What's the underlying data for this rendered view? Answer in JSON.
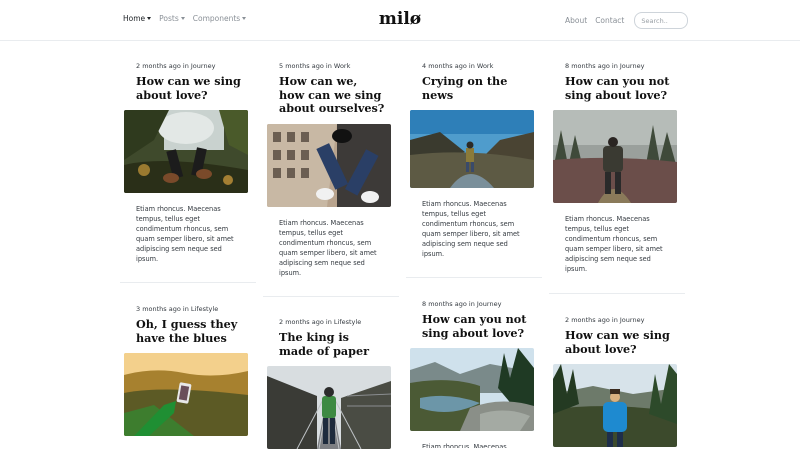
{
  "nav": {
    "brand": "milø",
    "left": [
      {
        "label": "Home",
        "dropdown": true,
        "active": true
      },
      {
        "label": "Posts",
        "dropdown": true,
        "active": false
      },
      {
        "label": "Components",
        "dropdown": true,
        "active": false
      }
    ],
    "about": "About",
    "contact": "Contact",
    "search_placeholder": "Search.."
  },
  "posts": [
    {
      "meta": "2 months ago in Journey",
      "title": "How can we sing about love?",
      "excerpt": "Etiam rhoncus. Maecenas tempus, tellus eget condimentum rhoncus, sem quam semper libero, sit amet adipiscing sem neque sed ipsum.",
      "image": "feet-leaves-image"
    },
    {
      "meta": "5 months ago in Work",
      "title": "How can we, how can we sing about ourselves?",
      "excerpt": "Etiam rhoncus. Maecenas tempus, tellus eget condimentum rhoncus, sem quam semper libero, sit amet adipiscing sem neque sed ipsum.",
      "image": "feet-building-image"
    },
    {
      "meta": "4 months ago in Work",
      "title": "Crying on the news",
      "excerpt": "Etiam rhoncus. Maecenas tempus, tellus eget condimentum rhoncus, sem quam semper libero, sit amet adipiscing sem neque sed ipsum.",
      "image": "mountain-valley-image"
    },
    {
      "meta": "8 months ago in Journey",
      "title": "How can you not sing about love?",
      "excerpt": "Etiam rhoncus. Maecenas tempus, tellus eget condimentum rhoncus, sem quam semper libero, sit amet adipiscing sem neque sed ipsum.",
      "image": "hiker-forest-image"
    },
    {
      "meta": "3 months ago in Lifestyle",
      "title": "Oh, I guess they have the blues",
      "image": "hand-phone-image"
    },
    {
      "meta": "2 months ago in Lifestyle",
      "title": "The king is made of paper",
      "image": "railway-image"
    },
    {
      "meta": "8 months ago in Journey",
      "title": "How can you not sing about love?",
      "excerpt_peek": "Etiam rhoncus. Maecenas",
      "image": "lake-valley-image"
    },
    {
      "meta": "2 months ago in Journey",
      "title": "How can we sing about love?",
      "image": "hiker-blue-jacket-image"
    }
  ]
}
